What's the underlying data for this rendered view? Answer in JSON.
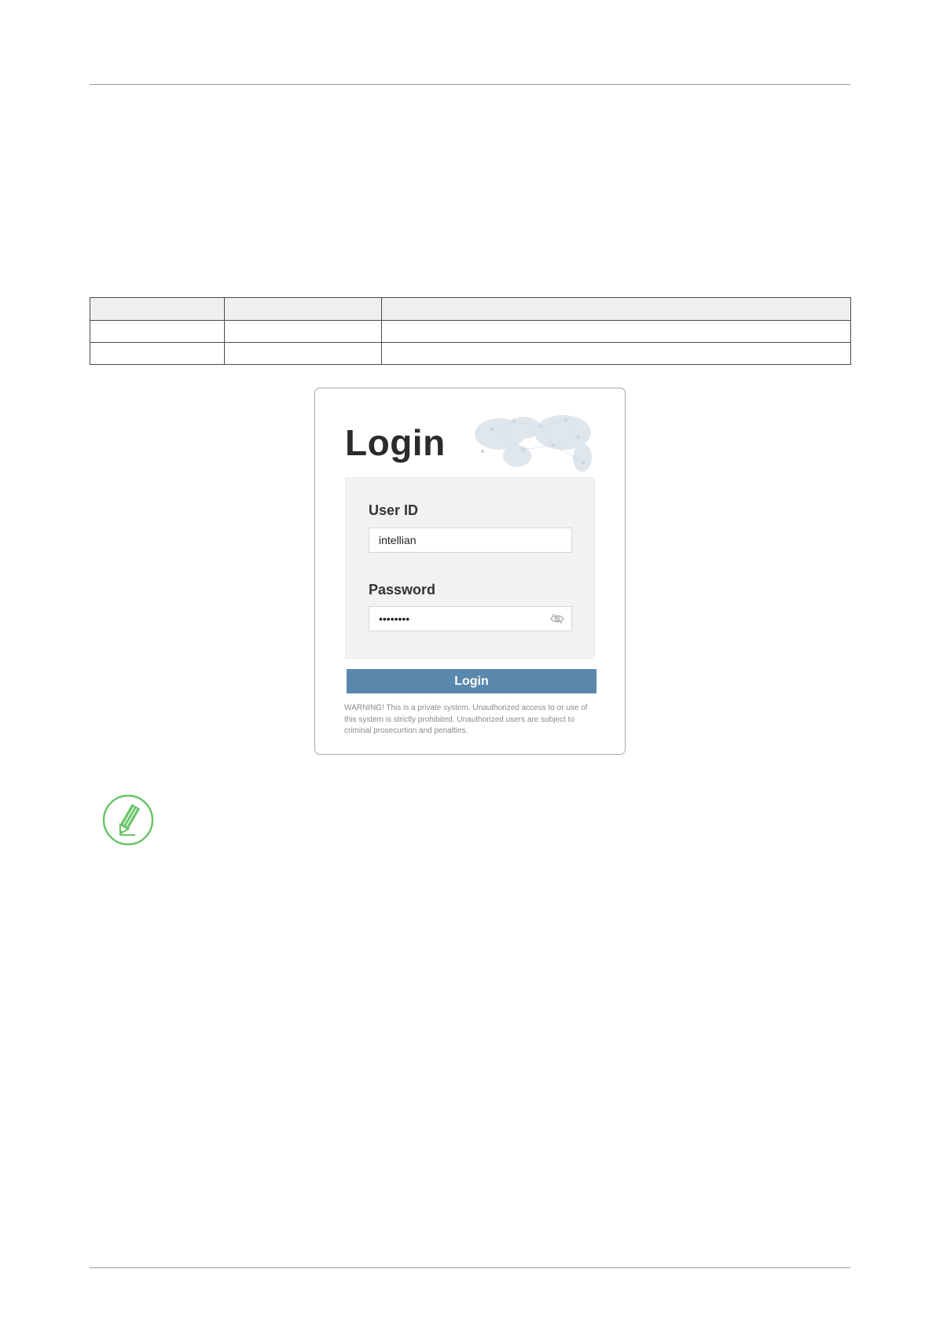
{
  "table": {
    "header": [
      "",
      "",
      ""
    ],
    "rows": [
      [
        "",
        "",
        ""
      ],
      [
        "",
        "",
        ""
      ]
    ]
  },
  "login": {
    "title": "Login",
    "user_label": "User ID",
    "user_value": "intellian",
    "password_label": "Password",
    "password_value": "••••••••",
    "button_label": "Login",
    "warning": "WARNING!  This is a private system. Unauthorized access to or use of this system is strictly prohibited. Unauthorized users are subject to criminal prosecurtion and penalties."
  },
  "icons": {
    "eye": "eye-slash-icon",
    "note": "pencil-note-icon",
    "map": "world-map-icon"
  },
  "colors": {
    "button": "#5a87ac",
    "note": "#6cc46a",
    "panel": "#f2f2f2"
  }
}
